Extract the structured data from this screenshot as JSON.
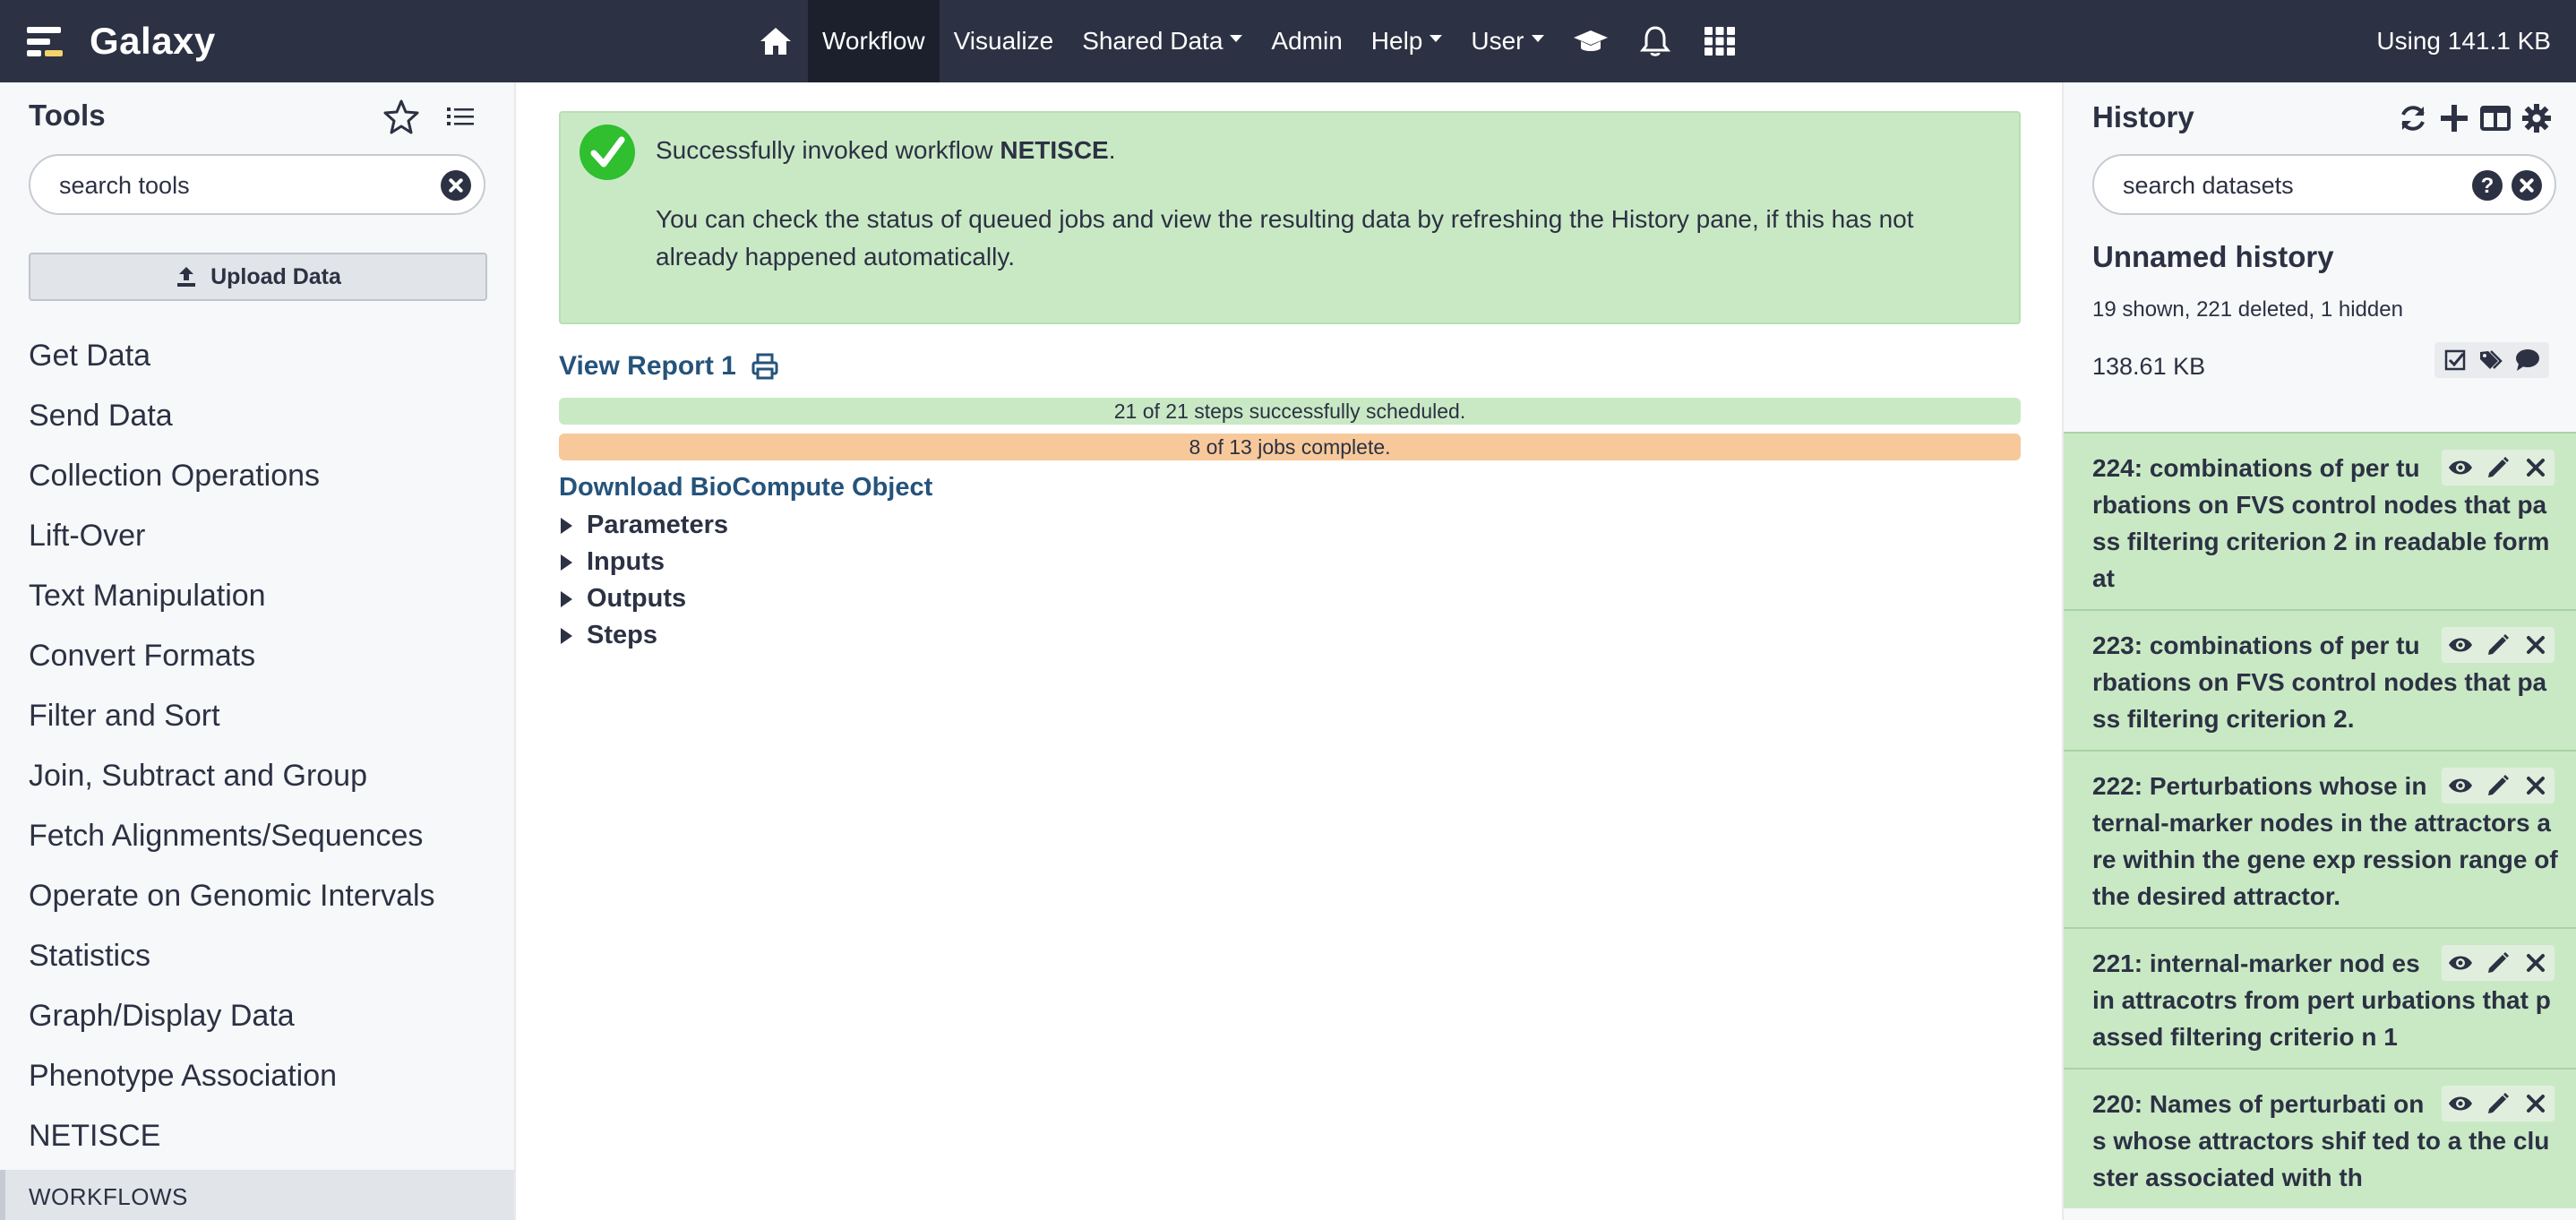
{
  "masthead": {
    "brand": "Galaxy",
    "nav": [
      {
        "id": "home",
        "icon": "home-icon"
      },
      {
        "id": "workflow",
        "label": "Workflow",
        "active": true
      },
      {
        "id": "visualize",
        "label": "Visualize"
      },
      {
        "id": "shared-data",
        "label": "Shared Data",
        "dropdown": true
      },
      {
        "id": "admin",
        "label": "Admin"
      },
      {
        "id": "help",
        "label": "Help",
        "dropdown": true
      },
      {
        "id": "user",
        "label": "User",
        "dropdown": true
      },
      {
        "id": "training",
        "icon": "graduation-cap-icon"
      },
      {
        "id": "notifications",
        "icon": "bell-icon"
      },
      {
        "id": "apps",
        "icon": "grid-icon"
      }
    ],
    "quota": "Using 141.1 KB"
  },
  "tool_panel": {
    "title": "Tools",
    "search_placeholder": "search tools",
    "upload_label": "Upload Data",
    "sections": [
      "Get Data",
      "Send Data",
      "Collection Operations",
      "Lift-Over",
      "Text Manipulation",
      "Convert Formats",
      "Filter and Sort",
      "Join, Subtract and Group",
      "Fetch Alignments/Sequences",
      "Operate on Genomic Intervals",
      "Statistics",
      "Graph/Display Data",
      "Phenotype Association",
      "NETISCE"
    ],
    "workflows_label": "WORKFLOWS"
  },
  "center": {
    "alert": {
      "prefix": "Successfully invoked workflow ",
      "workflow_name": "NETISCE",
      "suffix": ".",
      "detail": "You can check the status of queued jobs and view the resulting data by refreshing the History pane, if this has not already happened automatically."
    },
    "report_link": "View Report 1",
    "steps_progress": {
      "text": "21 of 21 steps successfully scheduled.",
      "done": 21,
      "total": 21
    },
    "jobs_progress": {
      "text": "8 of 13 jobs complete.",
      "done": 8,
      "total": 13
    },
    "bco_link": "Download BioCompute Object",
    "sections": [
      "Parameters",
      "Inputs",
      "Outputs",
      "Steps"
    ]
  },
  "history": {
    "title": "History",
    "search_placeholder": "search datasets",
    "name": "Unnamed history",
    "counts": "19 shown, 221 deleted, 1 hidden",
    "size": "138.61 KB",
    "datasets": [
      {
        "hid": "224",
        "title": "224: combinations of per turbations on FVS control nodes that pass filtering criterion 2 in readable format"
      },
      {
        "hid": "223",
        "title": "223: combinations of per turbations on FVS control nodes that pass filtering criterion 2."
      },
      {
        "hid": "222",
        "title": "222: Perturbations whose internal-marker nodes in the attractors are within the gene exp ression range of the desired attractor."
      },
      {
        "hid": "221",
        "title": "221: internal-marker nod es in attracotrs from pert urbations that passed filtering criterio n 1"
      },
      {
        "hid": "220",
        "title": "220: Names of perturbati ons whose attractors shif ted to a the cluster associated with th"
      }
    ]
  }
}
